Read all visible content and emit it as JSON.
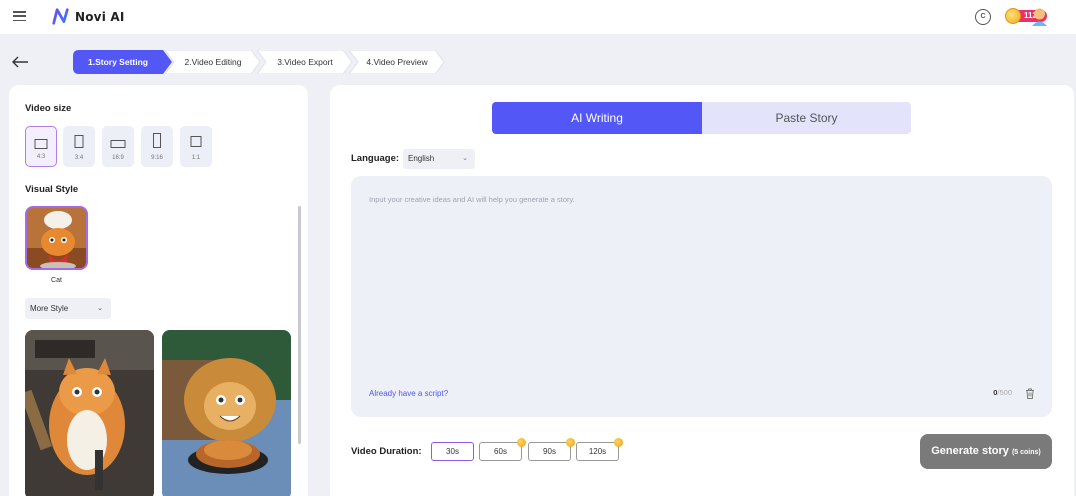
{
  "app": {
    "name": "Novi AI"
  },
  "header": {
    "coin_count": "1124"
  },
  "steps": [
    {
      "label": "1.Story Setting",
      "active": true
    },
    {
      "label": "2.Video Editing",
      "active": false
    },
    {
      "label": "3.Video Export",
      "active": false
    },
    {
      "label": "4.Video Preview",
      "active": false
    }
  ],
  "left": {
    "video_size_title": "Video size",
    "sizes": [
      {
        "label": "4:3",
        "selected": true
      },
      {
        "label": "3:4",
        "selected": false
      },
      {
        "label": "16:9",
        "selected": false
      },
      {
        "label": "9:16",
        "selected": false
      },
      {
        "label": "1:1",
        "selected": false
      }
    ],
    "visual_style_title": "Visual Style",
    "style_caption": "Cat",
    "more_style": "More Style"
  },
  "right": {
    "tabs": [
      {
        "label": "AI Writing",
        "active": true
      },
      {
        "label": "Paste Story",
        "active": false
      }
    ],
    "language_label": "Language:",
    "language_value": "English",
    "story_placeholder": "Input your creative ideas and AI will help you generate a story.",
    "script_link": "Already have a script?",
    "char_current": "0",
    "char_max": "/500",
    "duration_label": "Video Duration:",
    "durations": [
      {
        "label": "30s",
        "selected": true,
        "coin": false
      },
      {
        "label": "60s",
        "selected": false,
        "coin": true
      },
      {
        "label": "90s",
        "selected": false,
        "coin": true
      },
      {
        "label": "120s",
        "selected": false,
        "coin": true
      }
    ],
    "generate_label": "Generate story",
    "generate_cost": "(5 coins)"
  },
  "colors": {
    "accent": "#5257f5",
    "selected_border": "#a36be8",
    "coin_badge": "#e8316d",
    "generate_button": "#7a7a7a"
  }
}
